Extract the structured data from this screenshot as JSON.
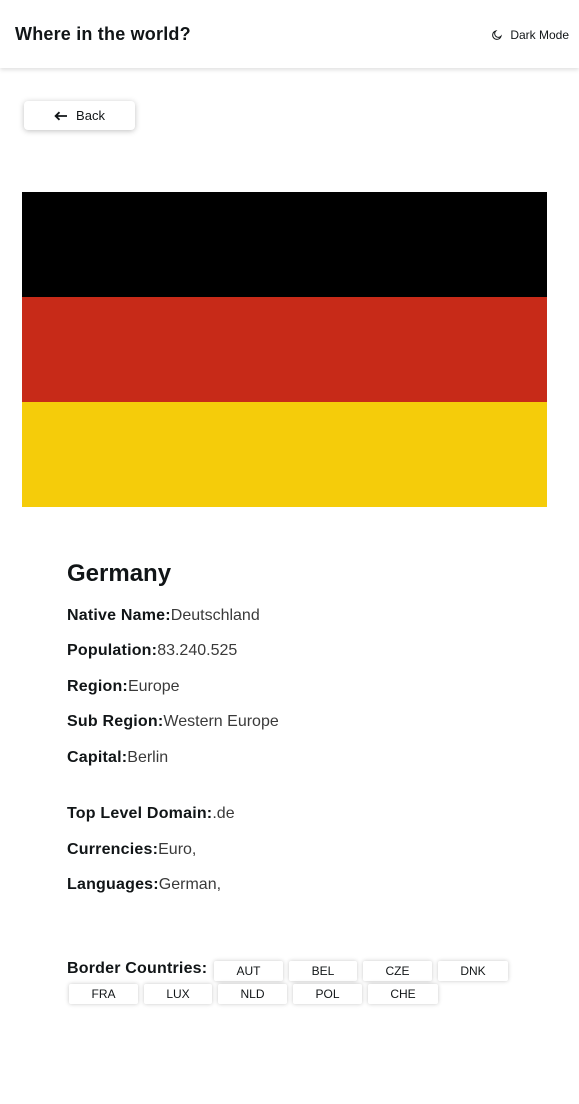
{
  "header": {
    "title": "Where in the world?",
    "mode_label": "Dark Mode"
  },
  "back_label": "Back",
  "flag": {
    "colors": [
      "#000000",
      "#c72a18",
      "#f5cc0a"
    ]
  },
  "country": {
    "name": "Germany",
    "native_name_label": "Native Name:",
    "native_name": "Deutschland",
    "population_label": "Population:",
    "population": "83.240.525",
    "region_label": "Region:",
    "region": "Europe",
    "subregion_label": "Sub Region:",
    "subregion": "Western Europe",
    "capital_label": "Capital:",
    "capital": "Berlin",
    "tld_label": "Top Level Domain:",
    "tld": ".de",
    "currencies_label": "Currencies:",
    "currencies": "Euro,",
    "languages_label": "Languages:",
    "languages": "German,"
  },
  "borders": {
    "label": "Border Countries:",
    "countries": [
      "AUT",
      "BEL",
      "CZE",
      "DNK",
      "FRA",
      "LUX",
      "NLD",
      "POL",
      "CHE"
    ]
  }
}
